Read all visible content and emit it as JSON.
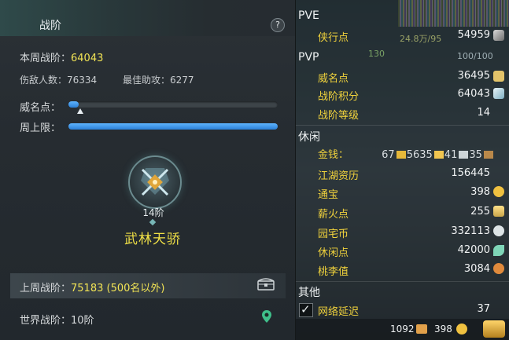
{
  "left": {
    "title": "战阶",
    "help": "?",
    "this_week_label": "本周战阶：",
    "this_week_value": "64043",
    "kills_label": "伤敌人数：",
    "kills_value": "76334",
    "best_assist_label": "最佳助攻：",
    "best_assist_value": "6277",
    "fame_label": "威名点：",
    "fame_progress": 0.05,
    "cap_label": "周上限：",
    "cap_progress": 1.0,
    "rank_text": "14阶",
    "rank_name": "武林天骄",
    "last_week_label": "上周战阶：",
    "last_week_value": "75183 (500名以外)",
    "world_label": "世界战阶：",
    "world_value": "10阶"
  },
  "right": {
    "pve": {
      "header": "PVE",
      "items": [
        {
          "label": "侠行点",
          "value": "54959",
          "icon": "brush-icon"
        }
      ]
    },
    "pvp": {
      "header": "PVP",
      "items": [
        {
          "label": "威名点",
          "value": "36495",
          "icon": "scroll-icon"
        },
        {
          "label": "战阶积分",
          "value": "64043",
          "icon": "crystal-icon"
        },
        {
          "label": "战阶等级",
          "value": "14",
          "icon": ""
        }
      ]
    },
    "leisure": {
      "header": "休闲",
      "money_label": "金钱：",
      "money_gold": "67",
      "money_silver": "5635",
      "money_copper": "41",
      "money_extra": "35",
      "items": [
        {
          "label": "江湖资历",
          "value": "156445",
          "icon": ""
        },
        {
          "label": "通宝",
          "value": "398",
          "icon": "coin-icon"
        },
        {
          "label": "薪火点",
          "value": "255",
          "icon": "flame-icon"
        },
        {
          "label": "园宅币",
          "value": "332113",
          "icon": "shell-icon"
        },
        {
          "label": "休闲点",
          "value": "42000",
          "icon": "leaf-icon"
        },
        {
          "label": "桃李值",
          "value": "3084",
          "icon": "gourd-icon"
        }
      ]
    },
    "other": {
      "header": "其他",
      "latency_label": "网络延迟",
      "latency_value": "37"
    },
    "bottom": {
      "value_a": "1092",
      "value_b": "398"
    },
    "bg_texts": {
      "t1": "24.8万/95",
      "t2": "130",
      "t3": "100/100"
    }
  },
  "colors": {
    "accent_yellow": "#f2e455",
    "label_gold": "#f0d23c",
    "progress_blue": "#3f95e8"
  }
}
